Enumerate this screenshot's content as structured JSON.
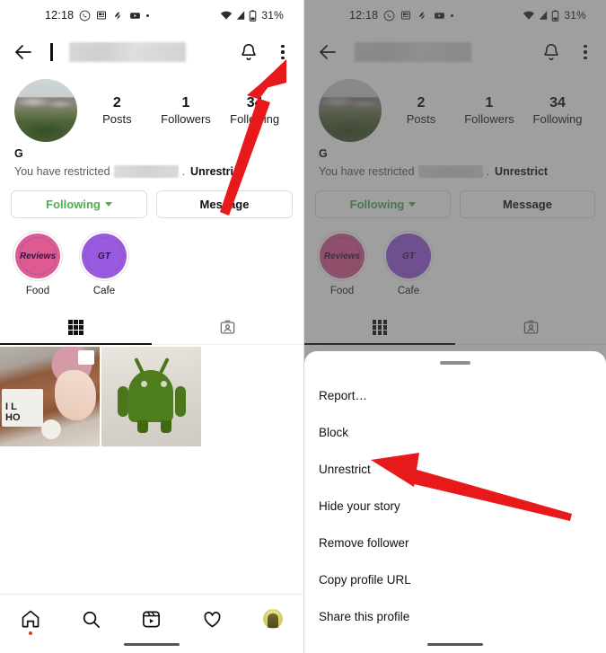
{
  "status_bar": {
    "time": "12:18",
    "battery_percent": "31%",
    "icons": [
      "whatsapp-icon",
      "news-icon",
      "app-icon",
      "youtube-icon",
      "more-dot-icon"
    ],
    "right_icons": [
      "wifi-icon",
      "cellular-signal-icon",
      "battery-icon"
    ]
  },
  "app_bar": {
    "back_label": "Back",
    "username_redacted": "",
    "notification_label": "Notifications",
    "menu_label": "More options"
  },
  "profile": {
    "display_name": "G",
    "stats": [
      {
        "count": "2",
        "label": "Posts"
      },
      {
        "count": "1",
        "label": "Followers"
      },
      {
        "count": "34",
        "label": "Following"
      }
    ],
    "restricted_prefix": "You have restricted",
    "restricted_suffix": ".",
    "restricted_action": "Unrestrict",
    "buttons": {
      "following": "Following",
      "message": "Message"
    },
    "highlights": [
      {
        "label": "Food",
        "cover_text": "Reviews",
        "color": "#e05a92"
      },
      {
        "label": "Cafe",
        "cover_text": "GT",
        "color": "#9a5ae0"
      }
    ],
    "tabs": [
      {
        "name": "grid-tab",
        "active": true
      },
      {
        "name": "tagged-tab",
        "active": false
      }
    ]
  },
  "bottom_nav": {
    "items": [
      "home-icon",
      "search-icon",
      "reels-icon",
      "activity-icon",
      "profile-avatar"
    ]
  },
  "bottom_sheet": {
    "items": [
      "Report…",
      "Block",
      "Unrestrict",
      "Hide your story",
      "Remove follower",
      "Copy profile URL",
      "Share this profile"
    ]
  },
  "annotations": {
    "arrow_color": "#e8191a",
    "left_arrow_target": "More options (three-dot) menu",
    "right_arrow_target": "Unrestrict menu item"
  }
}
